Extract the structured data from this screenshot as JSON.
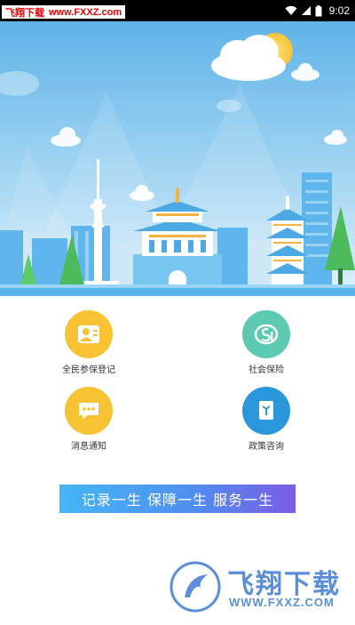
{
  "status_bar": {
    "time": "9:02",
    "watermark_name": "飞翔下载",
    "watermark_url": "www.FXXZ.com"
  },
  "services": [
    {
      "label": "全民参保登记",
      "icon": "person-card-icon",
      "color": "#f7c233"
    },
    {
      "label": "社会保险",
      "icon": "social-security-logo-icon",
      "color": "#5cc9b0"
    },
    {
      "label": "消息通知",
      "icon": "chat-bubble-icon",
      "color": "#f7c233"
    },
    {
      "label": "政策咨询",
      "icon": "document-icon",
      "color": "#2a97dd"
    }
  ],
  "slogan": "记录一生  保障一生  服务一生",
  "bottom_watermark": {
    "name": "飞翔下载",
    "url": "WWW.FXXZ.COM"
  }
}
